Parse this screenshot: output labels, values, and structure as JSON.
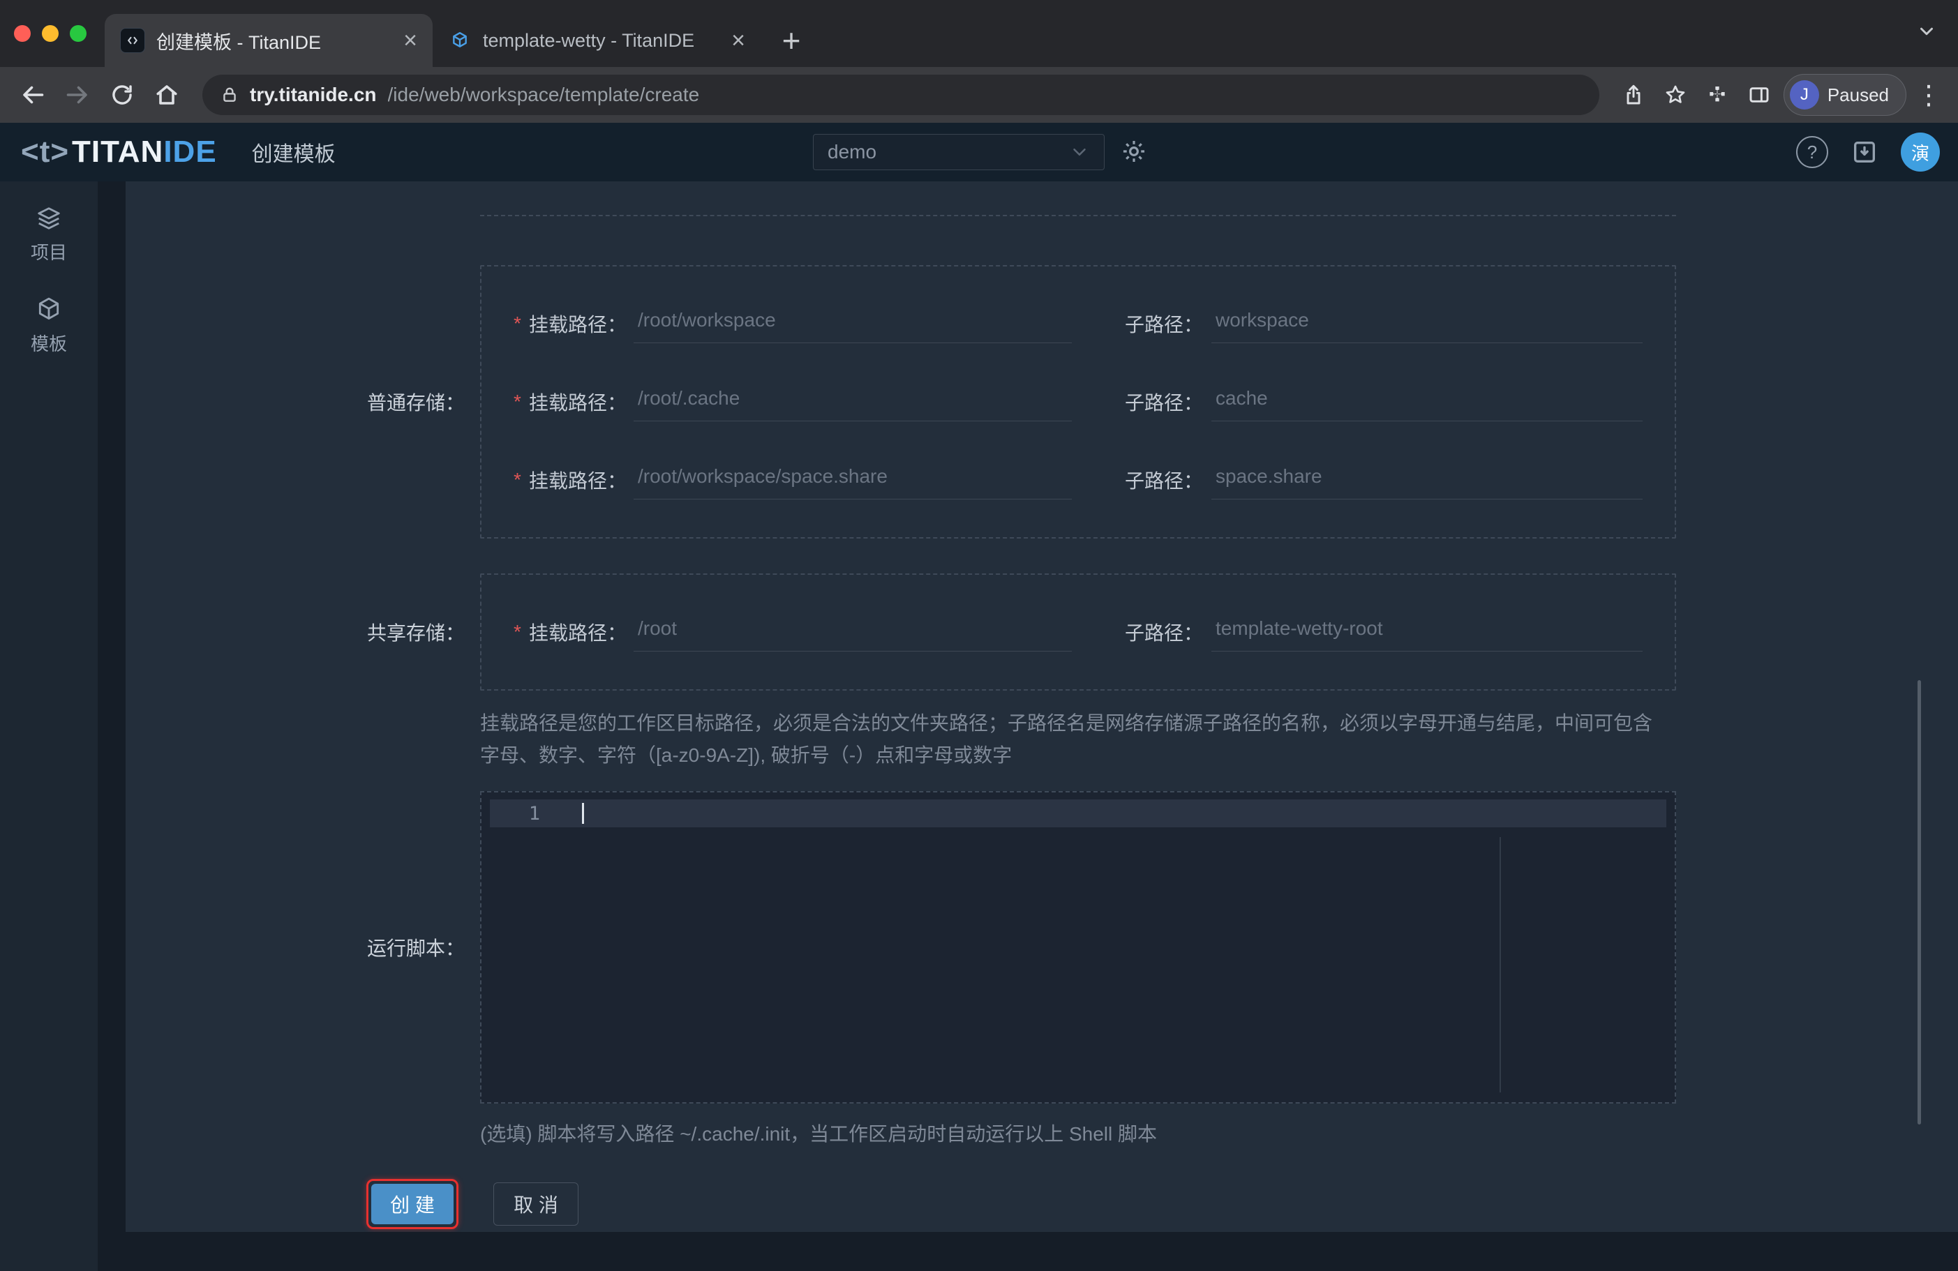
{
  "browser": {
    "tabs": [
      {
        "title": "创建模板 - TitanIDE",
        "active": true
      },
      {
        "title": "template-wetty - TitanIDE",
        "active": false
      }
    ],
    "url_domain": "try.titanide.cn",
    "url_path": "/ide/web/workspace/template/create",
    "profile": {
      "initial": "J",
      "label": "Paused"
    }
  },
  "icons": {
    "close": "×",
    "new_tab": "+",
    "menu": "⋮",
    "help": "?"
  },
  "header": {
    "logo": {
      "bracket": "<t>",
      "titan": "TITAN",
      "ide": "IDE"
    },
    "page_title": "创建模板",
    "workspace_select": {
      "value": "demo"
    },
    "avatar_text": "演"
  },
  "sidebar": {
    "items": [
      {
        "label": "项目",
        "icon": "layers-icon"
      },
      {
        "label": "模板",
        "icon": "cube-icon"
      }
    ]
  },
  "form": {
    "required_mark": "*",
    "sections": [
      {
        "label": "普通存储：",
        "rows": [
          {
            "mount_label": "挂载路径：",
            "mount_value": "/root/workspace",
            "sub_label": "子路径：",
            "sub_value": "workspace"
          },
          {
            "mount_label": "挂载路径：",
            "mount_value": "/root/.cache",
            "sub_label": "子路径：",
            "sub_value": "cache"
          },
          {
            "mount_label": "挂载路径：",
            "mount_value": "/root/workspace/space.share",
            "sub_label": "子路径：",
            "sub_value": "space.share"
          }
        ]
      },
      {
        "label": "共享存储：",
        "rows": [
          {
            "mount_label": "挂载路径：",
            "mount_value": "/root",
            "sub_label": "子路径：",
            "sub_value": "template-wetty-root"
          }
        ]
      }
    ],
    "path_help": "挂载路径是您的工作区目标路径，必须是合法的文件夹路径；子路径名是网络存储源子路径的名称，必须以字母开通与结尾，中间可包含字母、数字、字符（[a-z0-9A-Z]), 破折号（-）点和字母或数字",
    "script": {
      "label": "运行脚本：",
      "line_number": "1",
      "help": "(选填) 脚本将写入路径 ~/.cache/.init，当工作区启动时自动运行以上 Shell 脚本"
    },
    "buttons": {
      "create": "创 建",
      "cancel": "取 消"
    }
  },
  "colors": {
    "accent_blue": "#4a90c8",
    "highlight_ring": "#e8312f",
    "required_red": "#e05656"
  }
}
